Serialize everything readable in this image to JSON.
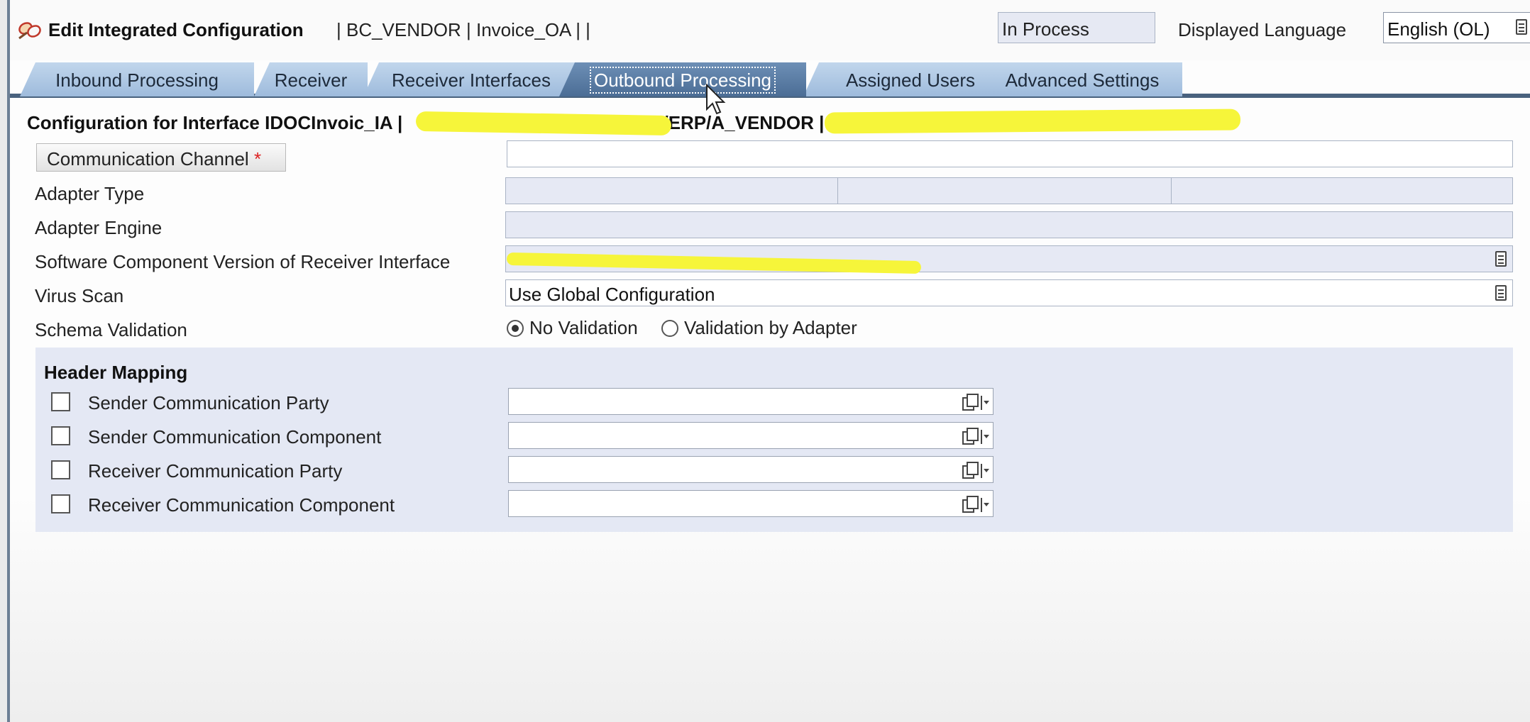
{
  "header": {
    "title": "Edit Integrated Configuration",
    "path": "| BC_VENDOR | Invoice_OA | |",
    "status": "In Process",
    "language_label": "Displayed Language",
    "language_value": "English (OL)"
  },
  "tabs": [
    {
      "label": "Inbound Processing",
      "active": false
    },
    {
      "label": "Receiver",
      "active": false
    },
    {
      "label": "Receiver Interfaces",
      "active": false
    },
    {
      "label": "Outbound Processing",
      "active": true
    },
    {
      "label": "Assigned Users",
      "active": false
    },
    {
      "label": "Advanced Settings",
      "active": false
    }
  ],
  "config": {
    "title_prefix": "Configuration for Interface IDOCInvoic_IA | ",
    "title_middle": "/ERP/A_VENDOR | "
  },
  "form": {
    "communication_channel_label": "Communication Channel",
    "required_marker": "*",
    "communication_channel_value": "",
    "adapter_type_label": "Adapter Type",
    "adapter_engine_label": "Adapter Engine",
    "swcv_label": "Software Component Version of Receiver Interface",
    "virus_scan_label": "Virus Scan",
    "virus_scan_value": "Use Global Configuration",
    "schema_validation_label": "Schema Validation",
    "schema_options": [
      "No Validation",
      "Validation by Adapter"
    ],
    "schema_selected": "No Validation"
  },
  "header_mapping": {
    "title": "Header Mapping",
    "rows": [
      {
        "label": "Sender Communication Party",
        "checked": false,
        "value": ""
      },
      {
        "label": "Sender Communication Component",
        "checked": false,
        "value": ""
      },
      {
        "label": "Receiver Communication Party",
        "checked": false,
        "value": ""
      },
      {
        "label": "Receiver Communication Component",
        "checked": false,
        "value": ""
      }
    ]
  },
  "colors": {
    "tab_active": "#4b6d95",
    "tab_inactive": "#a9c4e2",
    "readonly_field": "#e6e9f4",
    "highlight": "#f6f53a",
    "required": "#dd2222"
  },
  "icons": {
    "title": "integration-config-icon",
    "dropdown": "dropdown-list-icon",
    "value_help": "value-help-icon",
    "cursor": "mouse-pointer-icon"
  }
}
